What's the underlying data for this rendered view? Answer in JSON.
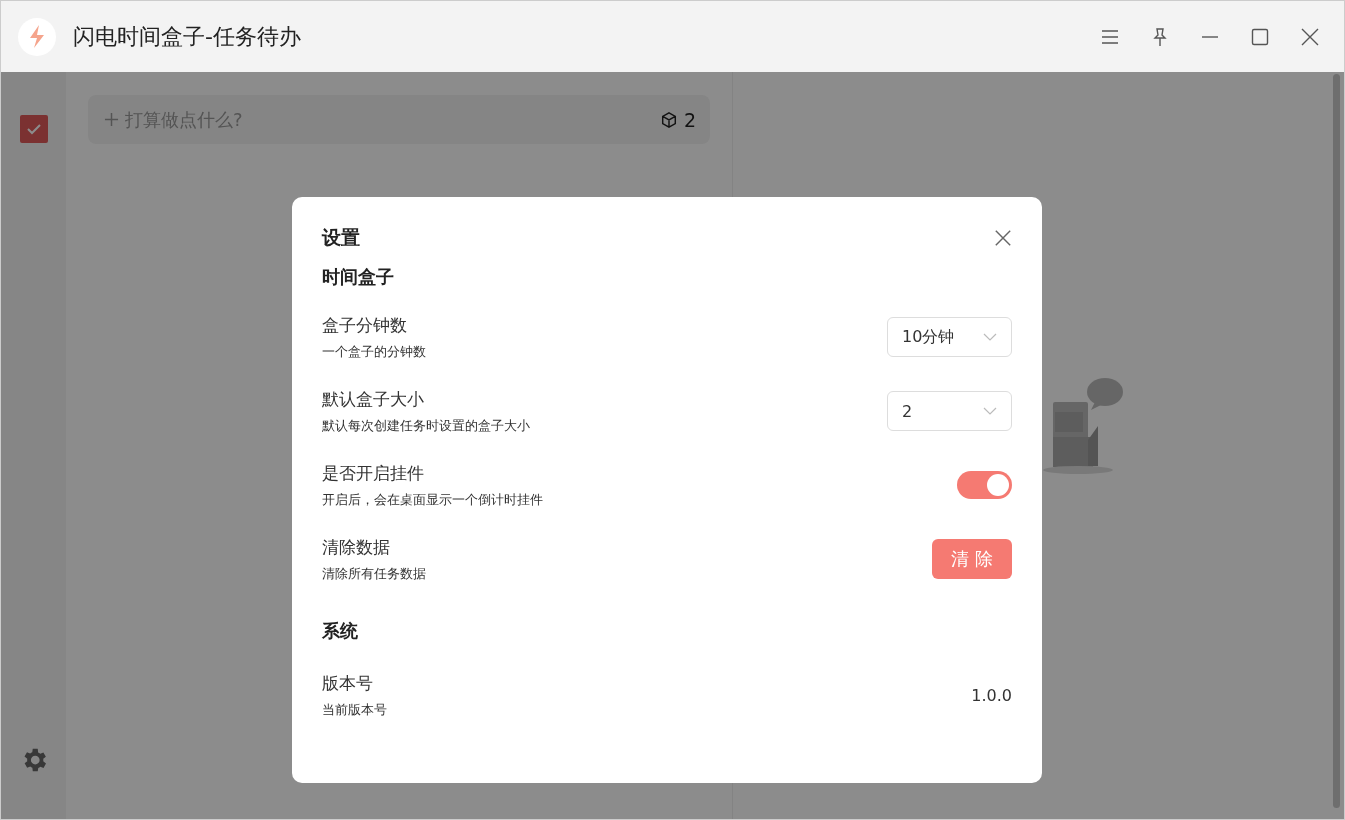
{
  "window": {
    "title": "闪电时间盒子-任务待办"
  },
  "task_input": {
    "placeholder": "打算做点什么?",
    "box_count": "2"
  },
  "settings": {
    "title": "设置",
    "sections": [
      {
        "title": "时间盒子",
        "items": [
          {
            "kind": "select",
            "label": "盒子分钟数",
            "description": "一个盒子的分钟数",
            "value": "10分钟"
          },
          {
            "kind": "select",
            "label": "默认盒子大小",
            "description": "默认每次创建任务时设置的盒子大小",
            "value": "2"
          },
          {
            "kind": "switch",
            "label": "是否开启挂件",
            "description": "开启后，会在桌面显示一个倒计时挂件",
            "on": true
          },
          {
            "kind": "button",
            "label": "清除数据",
            "description": "清除所有任务数据",
            "value": "清除"
          }
        ]
      },
      {
        "title": "系统",
        "items": [
          {
            "kind": "text",
            "label": "版本号",
            "description": "当前版本号",
            "value": "1.0.0"
          }
        ]
      }
    ]
  }
}
